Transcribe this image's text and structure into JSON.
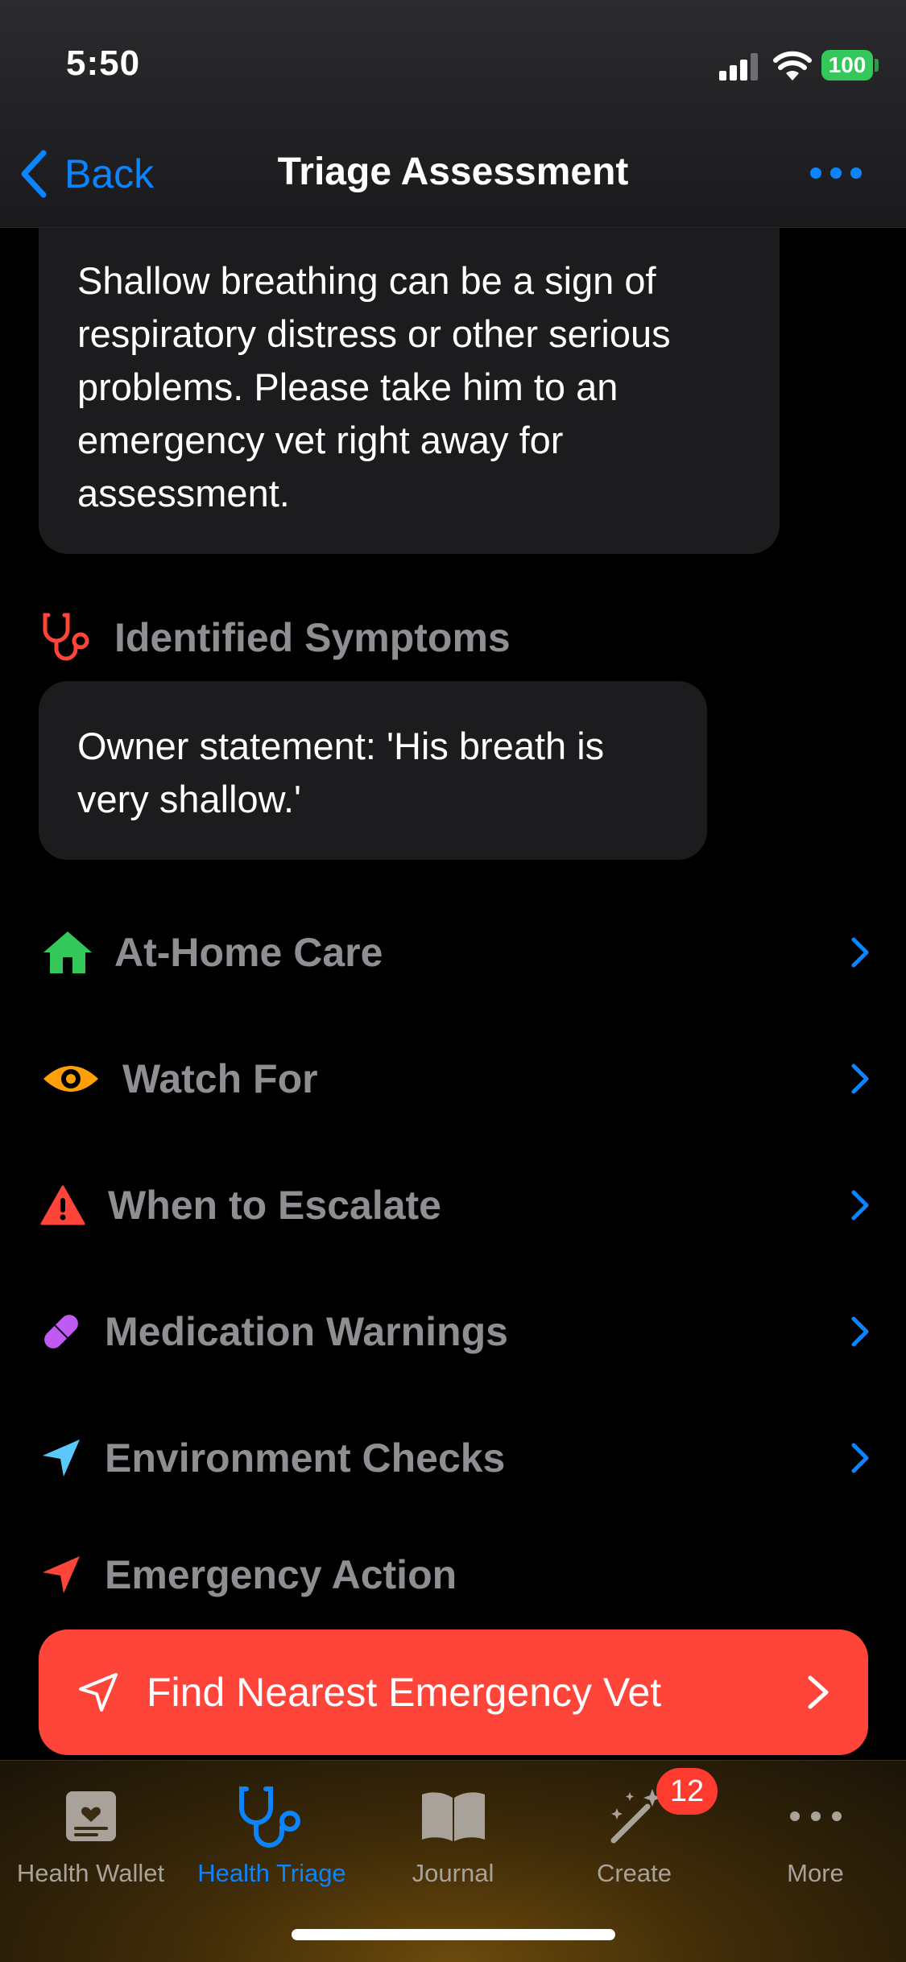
{
  "status_bar": {
    "time": "5:50",
    "battery": "100"
  },
  "nav": {
    "back_label": "Back",
    "title": "Triage Assessment"
  },
  "advice_text": "Shallow breathing can be a sign of respiratory distress or other serious problems. Please take him to an emergency vet right away for assessment.",
  "identified_symptoms": {
    "heading": "Identified Symptoms",
    "statement": "Owner statement: 'His breath is very shallow.'"
  },
  "sections": [
    {
      "label": "At-Home Care",
      "icon": "house-icon",
      "color": "#34c759"
    },
    {
      "label": "Watch For",
      "icon": "eye-icon",
      "color": "#ff9f0a"
    },
    {
      "label": "When to Escalate",
      "icon": "warning-triangle-icon",
      "color": "#ff453a"
    },
    {
      "label": "Medication Warnings",
      "icon": "pill-icon",
      "color": "#bf5af2"
    },
    {
      "label": "Environment Checks",
      "icon": "location-arrow-icon",
      "color": "#5ac8fa"
    }
  ],
  "emergency": {
    "heading": "Emergency Action",
    "button_label": "Find Nearest Emergency Vet"
  },
  "tabbar": {
    "tabs": [
      {
        "label": "Health Wallet",
        "icon": "wallet-card-icon",
        "active": false
      },
      {
        "label": "Health Triage",
        "icon": "stethoscope-icon",
        "active": true
      },
      {
        "label": "Journal",
        "icon": "book-icon",
        "active": false
      },
      {
        "label": "Create",
        "icon": "magic-wand-icon",
        "active": false,
        "badge": "12"
      },
      {
        "label": "More",
        "icon": "ellipsis-icon",
        "active": false
      }
    ]
  },
  "colors": {
    "accent": "#0a84ff",
    "emergency": "#ff453a",
    "bubble": "#1c1c1e"
  }
}
